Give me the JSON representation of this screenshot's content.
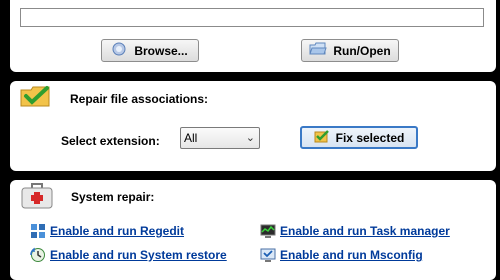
{
  "run": {
    "path_value": "",
    "browse_label": "Browse...",
    "run_label": "Run/Open"
  },
  "assoc": {
    "title": "Repair file associations:",
    "ext_label": "Select extension:",
    "ext_selected": "All",
    "fix_label": "Fix selected"
  },
  "sysrepair": {
    "title": "System repair:",
    "links": {
      "regedit": "Enable and run Regedit",
      "taskmgr": "Enable and run Task manager",
      "restore": "Enable and run System restore",
      "msconfig": "Enable and run Msconfig"
    }
  },
  "icons": {
    "browse": "folder-search-icon",
    "run": "open-folder-icon",
    "assoc": "checkmark-folder-icon",
    "fix": "checkmark-icon",
    "kit": "first-aid-kit-icon",
    "regedit": "registry-icon",
    "taskmgr": "task-manager-icon",
    "restore": "system-restore-icon",
    "msconfig": "msconfig-icon"
  },
  "colors": {
    "link": "#003a9a",
    "focus_border": "#3a79c6",
    "background": "#000000"
  }
}
